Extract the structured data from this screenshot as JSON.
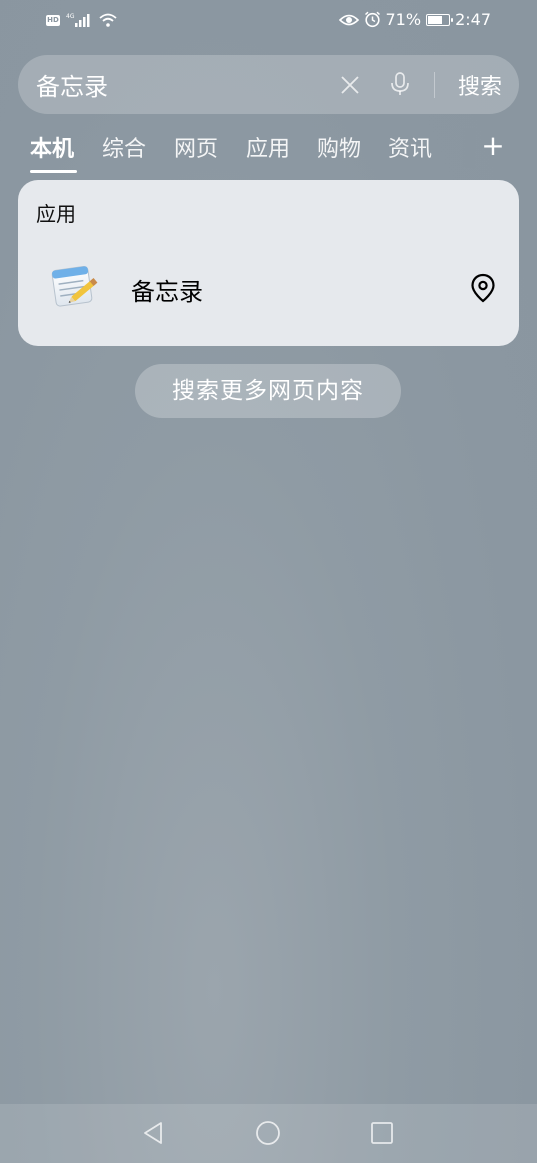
{
  "status_bar": {
    "time": "2:47",
    "battery_percent": "71%",
    "battery_level": 0.71,
    "network": "4G",
    "hd_badge": "HD"
  },
  "search": {
    "query": "备忘录",
    "submit_label": "搜索"
  },
  "tabs": [
    {
      "label": "本机",
      "active": true
    },
    {
      "label": "综合",
      "active": false
    },
    {
      "label": "网页",
      "active": false
    },
    {
      "label": "应用",
      "active": false
    },
    {
      "label": "购物",
      "active": false
    },
    {
      "label": "资讯",
      "active": false
    }
  ],
  "tab_add_label": "+",
  "results": {
    "section_title": "应用",
    "app": {
      "name": "备忘录",
      "icon": "notepad-icon"
    }
  },
  "more_button_label": "搜索更多网页内容",
  "icons": {
    "clear": "close-icon",
    "mic": "microphone-icon",
    "location": "location-pin-icon",
    "eye": "eye-comfort-icon",
    "alarm": "alarm-icon",
    "back": "back-triangle-icon",
    "home": "home-circle-icon",
    "recents": "recents-square-icon"
  },
  "colors": {
    "card_bg": "#e6e9ed",
    "background": "#8a96a0",
    "text_primary": "#000000",
    "text_on_bg": "#ffffff"
  }
}
